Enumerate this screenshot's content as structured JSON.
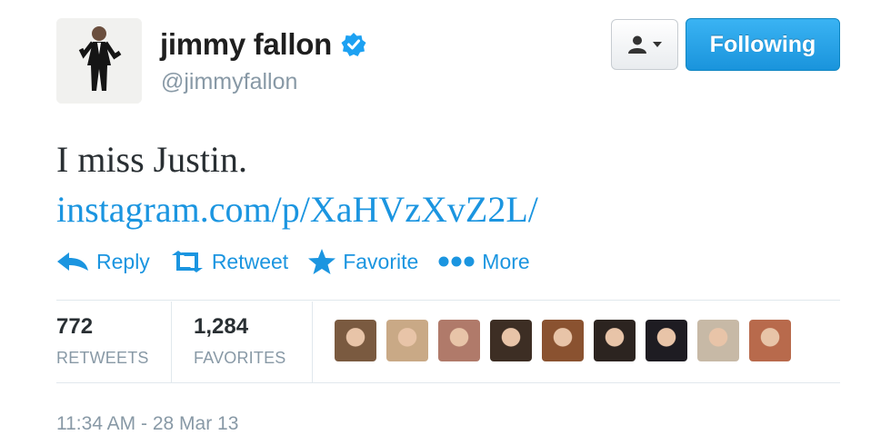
{
  "user": {
    "name": "jimmy fallon",
    "handle": "@jimmyfallon"
  },
  "buttons": {
    "following_label": "Following"
  },
  "tweet": {
    "text": "I miss Justin.",
    "link": "instagram.com/p/XaHVzXvZ2L/"
  },
  "actions": [
    {
      "label": "Reply",
      "icon": "reply-icon"
    },
    {
      "label": "Retweet",
      "icon": "retweet-icon"
    },
    {
      "label": "Favorite",
      "icon": "star-icon"
    },
    {
      "label": "More",
      "icon": "more-dots-icon"
    }
  ],
  "stats": {
    "retweets": {
      "count": "772",
      "label": "RETWEETS"
    },
    "favorites": {
      "count": "1,284",
      "label": "FAVORITES"
    }
  },
  "favoriter_avatars": [
    {
      "tone": "#7a5a40"
    },
    {
      "tone": "#c9a986"
    },
    {
      "tone": "#b07a6a"
    },
    {
      "tone": "#3d2e24"
    },
    {
      "tone": "#8a5230"
    },
    {
      "tone": "#2c2420"
    },
    {
      "tone": "#1e1c22"
    },
    {
      "tone": "#c7b9a6"
    },
    {
      "tone": "#b86a4c"
    }
  ],
  "timestamp": "11:34 AM - 28 Mar 13",
  "colors": {
    "link": "#1b95e0",
    "follow_button": "#2aa4ea",
    "verified": "#1da1f2"
  }
}
